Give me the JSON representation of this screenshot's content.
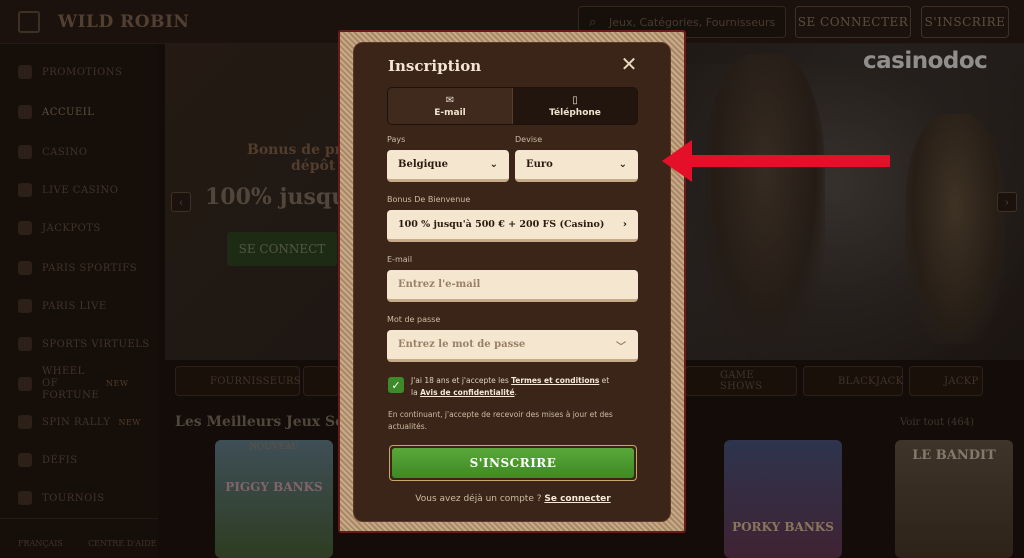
{
  "background": {
    "logo": "WILD ROBIN",
    "search_placeholder": "Jeux, Catégories, Fournisseurs",
    "login_label": "SE CONNECTER",
    "signup_label": "S'INSCRIRE",
    "sidebar": [
      {
        "label": "PROMOTIONS"
      },
      {
        "label": "ACCUEIL"
      },
      {
        "label": "CASINO"
      },
      {
        "label": "LIVE CASINO"
      },
      {
        "label": "JACKPOTS"
      },
      {
        "label": "PARIS SPORTIFS"
      },
      {
        "label": "PARIS LIVE"
      },
      {
        "label": "SPORTS VIRTUELS"
      },
      {
        "label": "WHEEL OF FORTUNE",
        "badge": "NEW"
      },
      {
        "label": "SPIN RALLY",
        "badge": "NEW"
      },
      {
        "label": "DÉFIS"
      },
      {
        "label": "TOURNOIS"
      }
    ],
    "sidebar_bottom": [
      "FRANÇAIS",
      "CENTRE D'AIDE"
    ],
    "hero_line1": "Bonus de pre",
    "hero_line1b": "dépôt",
    "hero_line2": "100% jusqu'",
    "hero_button": "SE CONNECT",
    "chips": [
      "FOURNISSEURS",
      "GAME SHOWS",
      "BLACKJACK",
      "JACKP"
    ],
    "section_title": "Les Meilleurs Jeux Séle",
    "see_all": "Voir tout (464)",
    "game_badge": "NOUVEAU",
    "game_titles": [
      "PIGGY BANKS",
      "PORKY BANKS",
      "LE BANDIT"
    ]
  },
  "watermark": "casinodoc",
  "modal": {
    "title": "Inscription",
    "tabs": [
      {
        "label": "E-mail",
        "icon": "envelope-icon",
        "glyph": "✉",
        "active": true
      },
      {
        "label": "Téléphone",
        "icon": "phone-icon",
        "glyph": "▯",
        "active": false
      }
    ],
    "country": {
      "label": "Pays",
      "value": "Belgique"
    },
    "currency": {
      "label": "Devise",
      "value": "Euro"
    },
    "bonus": {
      "label": "Bonus De Bienvenue",
      "value": "100 % jusqu'à 500 € + 200 FS (Casino)"
    },
    "email": {
      "label": "E-mail",
      "placeholder": "Entrez l'e-mail"
    },
    "password": {
      "label": "Mot de passe",
      "placeholder": "Entrez le mot de passe"
    },
    "terms_prefix": "J'ai 18 ans et j'accepte les ",
    "terms_link": "Termes et conditions",
    "terms_mid": " et la ",
    "privacy_link": "Avis de confidentialité",
    "terms_suffix": ".",
    "consent": "En continuant, j'accepte de recevoir des mises à jour et des actualités.",
    "submit": "S'INSCRIRE",
    "login_prompt": "Vous avez déjà un compte ? ",
    "login_link": "Se connecter"
  },
  "colors": {
    "accent_green": "#3e8a24",
    "annotation_arrow": "#e4102a",
    "modal_bg": "#3b2519",
    "field_bg": "#f5e6cf"
  }
}
